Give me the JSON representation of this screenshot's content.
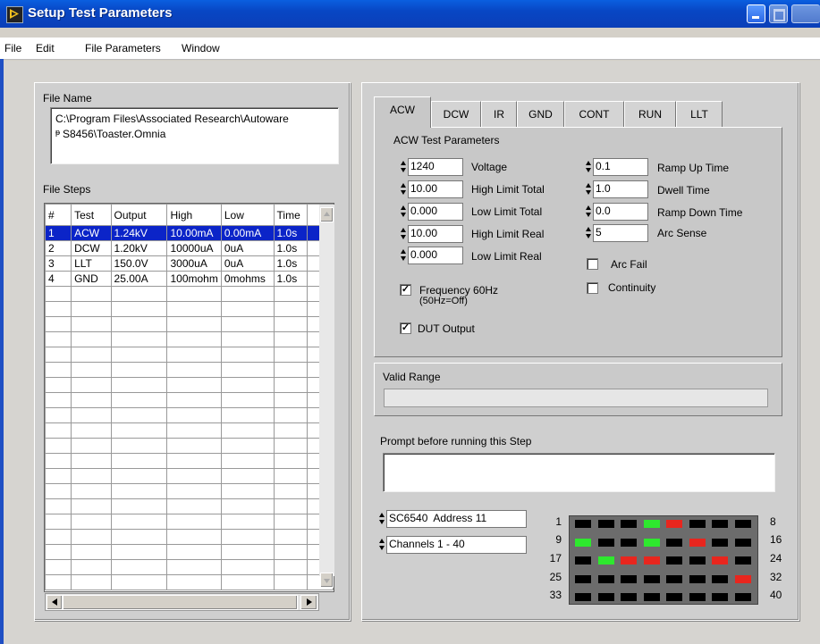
{
  "window": {
    "title": "Setup Test Parameters"
  },
  "menu": [
    "File",
    "Edit",
    "File Parameters",
    "Window"
  ],
  "file_name": {
    "label": "File Name",
    "line1": "C:\\Program Files\\Associated Research\\Autoware",
    "line2": "S8456\\Toaster.Omnia"
  },
  "file_steps": {
    "label": "File Steps",
    "headers": [
      "#",
      "Test",
      "Output",
      "High",
      "Low",
      "Time"
    ],
    "rows": [
      [
        "1",
        "ACW",
        "1.24kV",
        "10.00mA",
        "0.00mA",
        "1.0s"
      ],
      [
        "2",
        "DCW",
        "1.20kV",
        "10000uA",
        "0uA",
        "1.0s"
      ],
      [
        "3",
        "LLT",
        "150.0V",
        "3000uA",
        "0uA",
        "1.0s"
      ],
      [
        "4",
        "GND",
        "25.00A",
        "100mohm",
        "0mohms",
        "1.0s"
      ]
    ]
  },
  "tabs": [
    "ACW",
    "DCW",
    "IR",
    "GND",
    "CONT",
    "RUN",
    "LLT"
  ],
  "acw": {
    "group_label": "ACW Test Parameters",
    "left_params": [
      {
        "value": "1240",
        "label": "Voltage"
      },
      {
        "value": "10.00",
        "label": "High Limit Total"
      },
      {
        "value": "0.000",
        "label": "Low Limit Total"
      },
      {
        "value": "10.00",
        "label": "High Limit Real"
      },
      {
        "value": "0.000",
        "label": "Low Limit Real"
      }
    ],
    "right_params": [
      {
        "value": "0.1",
        "label": "Ramp Up Time"
      },
      {
        "value": "1.0",
        "label": "Dwell Time"
      },
      {
        "value": "0.0",
        "label": "Ramp Down Time"
      },
      {
        "value": "5",
        "label": "Arc Sense"
      }
    ],
    "checkboxes": {
      "frequency_line1": "Frequency 60Hz",
      "frequency_line2": "(50Hz=Off)",
      "frequency_checked": true,
      "dut_output": "DUT Output",
      "dut_checked": true,
      "arc_fail": "Arc Fail",
      "arc_fail_checked": false,
      "continuity": "Continuity",
      "continuity_checked": false
    }
  },
  "valid_range": {
    "label": "Valid Range",
    "value": ""
  },
  "prompt": {
    "label": "Prompt before running this Step",
    "value": ""
  },
  "scanner": {
    "device": "SC6540  Address 11",
    "channels": "Channels 1 - 40",
    "row_start_labels": [
      "1",
      "9",
      "17",
      "25",
      "33"
    ],
    "row_end_labels": [
      "8",
      "16",
      "24",
      "32",
      "40"
    ],
    "states": [
      [
        "off",
        "off",
        "off",
        "green",
        "red",
        "off",
        "off",
        "off"
      ],
      [
        "green",
        "off",
        "off",
        "green",
        "off",
        "red",
        "off",
        "off"
      ],
      [
        "off",
        "green",
        "red",
        "red",
        "off",
        "off",
        "red",
        "off"
      ],
      [
        "off",
        "off",
        "off",
        "off",
        "off",
        "off",
        "off",
        "red"
      ],
      [
        "off",
        "off",
        "off",
        "off",
        "off",
        "off",
        "off",
        "off"
      ]
    ],
    "colors": {
      "off": "#000000",
      "green": "#2ee82e",
      "red": "#e8261e"
    }
  }
}
